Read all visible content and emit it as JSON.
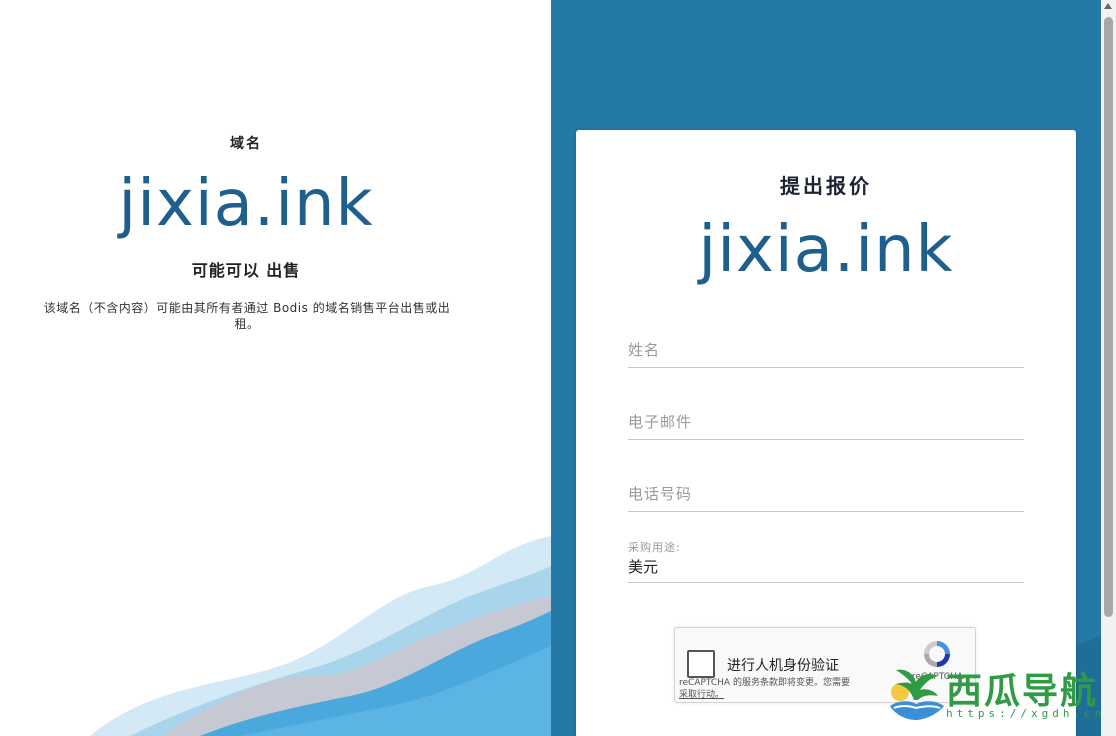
{
  "left": {
    "label": "域名",
    "domain": "jixia.ink",
    "sale_text": "可能可以 出售",
    "description": "该域名（不含内容）可能由其所有者通过 Bodis 的域名销售平台出售或出租。"
  },
  "form": {
    "title": "提出报价",
    "domain": "jixia.ink",
    "name_placeholder": "姓名",
    "email_placeholder": "电子邮件",
    "phone_placeholder": "电话号码",
    "purpose_label": "采购用途:",
    "purpose_value": "美元"
  },
  "recaptcha": {
    "label": "进行人机身份验证",
    "brand": "reCAPTCHA",
    "terms_text": "reCAPTCHA 的服务条款即将变更。您需要",
    "terms_link": "采取行动。"
  },
  "watermark": {
    "title": "西瓜导航",
    "url": "https://xgdh.cn"
  },
  "colors": {
    "accent": "#2579a6",
    "domain_text": "#1f5f8e",
    "wave_light": "#a8d4ec",
    "wave_mid": "#8ec6e6",
    "wave_dark": "#4aa8dc"
  }
}
